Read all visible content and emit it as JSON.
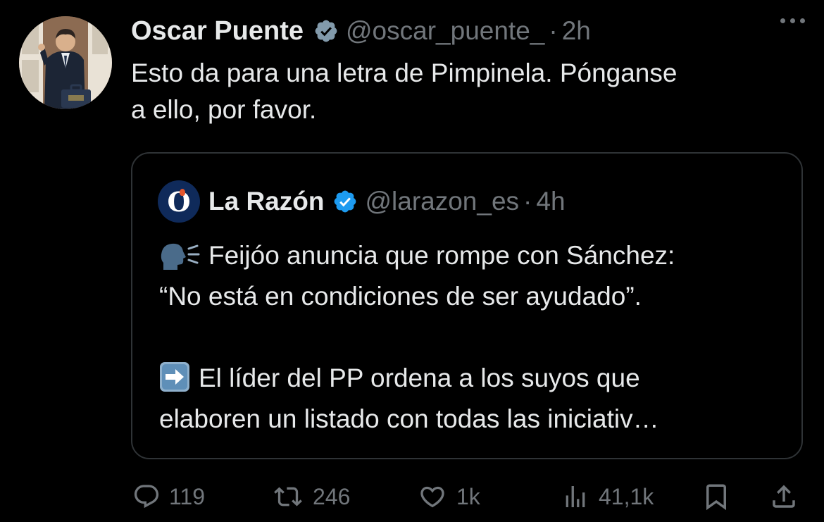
{
  "tweet": {
    "display_name": "Oscar Puente",
    "handle": "@oscar_puente_",
    "separator": "·",
    "time": "2h",
    "text_line1": "Esto da para una letra de Pimpinela. Pónganse",
    "text_line2": "a ello, por favor."
  },
  "quoted": {
    "avatar_letter": "O",
    "display_name": "La Razón",
    "handle": "@larazon_es",
    "separator": "·",
    "time": "4h",
    "line1": "Feijóo anuncia que rompe con Sánchez:",
    "line2": "“No está en condiciones de ser ayudado”.",
    "line3": "El líder del PP ordena a los suyos que",
    "line4": "elaboren un listado con todas las iniciativ…"
  },
  "actions": {
    "replies": "119",
    "reposts": "246",
    "likes": "1k",
    "views": "41,1k"
  },
  "icons": {
    "verified": "verified-badge-icon",
    "more": "more-options-icon",
    "reply": "reply-icon",
    "repost": "repost-icon",
    "like": "like-icon",
    "views": "views-icon",
    "bookmark": "bookmark-icon",
    "share": "share-icon",
    "speaking_head": "speaking-head-emoji",
    "right_arrow": "right-arrow-emoji"
  },
  "colors": {
    "background": "#000000",
    "primary_text": "#e7e9ea",
    "secondary_text": "#71767b",
    "verified_blue": "#1d9bf0",
    "verified_gray": "#829aab",
    "border": "#2f3336"
  }
}
